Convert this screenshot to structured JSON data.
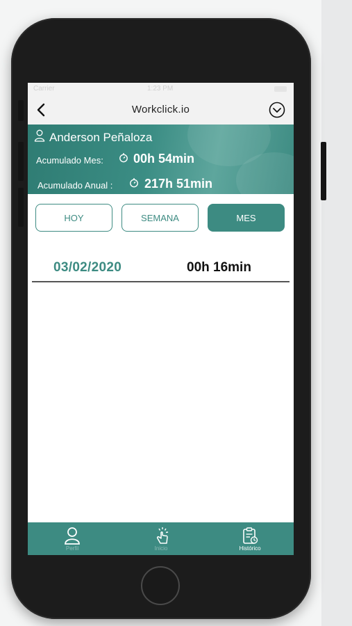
{
  "status_bar": {
    "carrier": "Carrier",
    "time": "1:23 PM"
  },
  "nav": {
    "title": "Workclick.io",
    "back_icon": "chevron-left-icon",
    "menu_icon": "chevron-down-circle-icon"
  },
  "profile": {
    "name": "Anderson Peñaloza",
    "monthly_label": "Acumulado Mes:",
    "monthly_value": "00h 54min",
    "annual_label": "Acumulado Anual :",
    "annual_value": "217h 51min"
  },
  "period_tabs": {
    "day": "HOY",
    "week": "SEMANA",
    "month": "MES",
    "selected": "MES"
  },
  "records": [
    {
      "date": "03/02/2020",
      "time": "00h 16min"
    }
  ],
  "tabbar": {
    "items": [
      {
        "label": "Perfil",
        "icon": "user-icon",
        "active": false
      },
      {
        "label": "Inicio",
        "icon": "tap-icon",
        "active": false
      },
      {
        "label": "Histórico",
        "icon": "clipboard-icon",
        "active": true
      }
    ]
  },
  "colors": {
    "accent": "#3d8b82",
    "device": "#1c1c1c",
    "background": "#f4f5f5"
  }
}
